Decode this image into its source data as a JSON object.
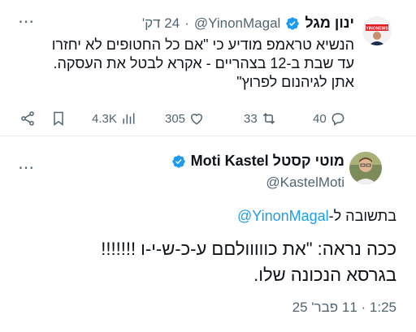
{
  "colors": {
    "accent": "#1d9bf0",
    "muted": "#536471",
    "text": "#0f1419"
  },
  "quoted_tweet": {
    "author_name": "ינון מגל",
    "handle": "@YinonMagal",
    "separator": "·",
    "time": "24 דק'",
    "avatar_badge": "YINONEWS",
    "text_lines": [
      "הנשיא טראמפ מודיע כי \"אם כל החטופים לא יחזרו",
      "עד שבת ב-12 בצהריים - אקרא לבטל את העסקה.",
      "אתן לגיהנום לפרוץ\""
    ],
    "actions": {
      "share_icon": "share-icon",
      "bookmark_icon": "bookmark-icon",
      "views": "4.3K",
      "likes": "305",
      "retweets": "33",
      "replies": "40"
    }
  },
  "main_tweet": {
    "author_name": "מוטי קסטל Moti Kastel",
    "handle": "@KastelMoti",
    "reply_prefix": "בתשובה ל-",
    "reply_to": "@YinonMagal",
    "text_lines": [
      "ככה נראה: \"את כווווולםם ע-כ-ש-י-ו !!!!!!!",
      "בגרסא הנכונה שלו."
    ],
    "timestamp": "1:25 · 11 פבר' 25"
  }
}
